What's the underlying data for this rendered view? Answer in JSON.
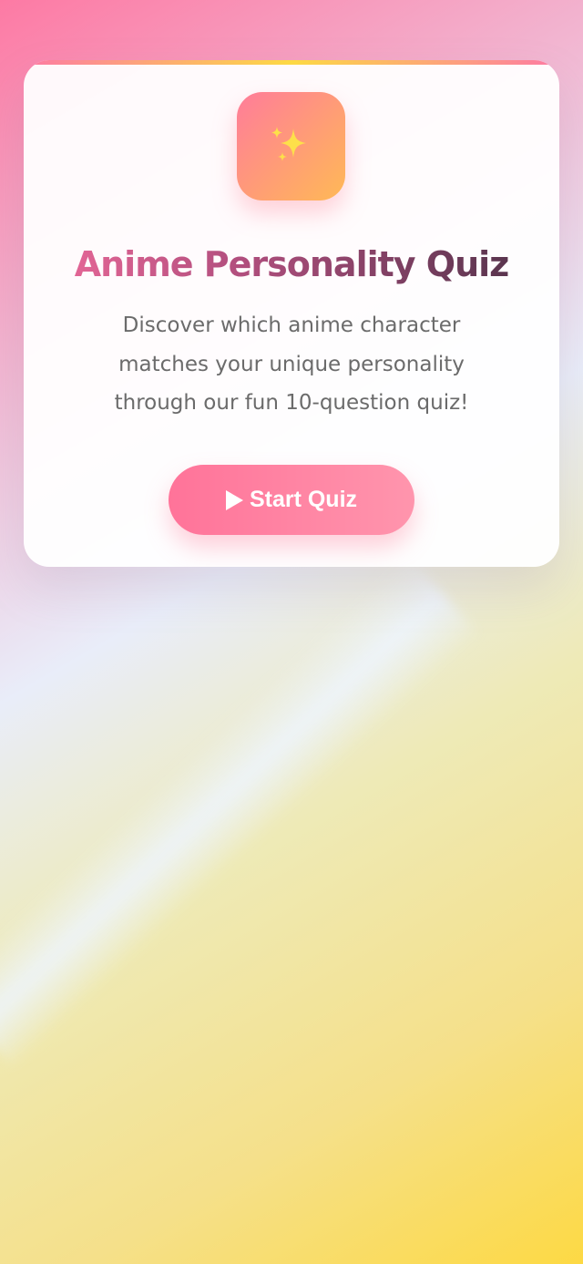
{
  "quiz_card": {
    "icon": "sparkles-icon",
    "title": "Anime Personality Quiz",
    "description": "Discover which anime character matches your unique personality through our fun 10-question quiz!",
    "start_button": {
      "icon": "play-icon",
      "label": "Start Quiz"
    }
  },
  "colors": {
    "accent_pink": "#ff7399",
    "accent_yellow": "#fdd944",
    "title_dark": "#4a3046",
    "body_text": "#6b6b6b"
  }
}
